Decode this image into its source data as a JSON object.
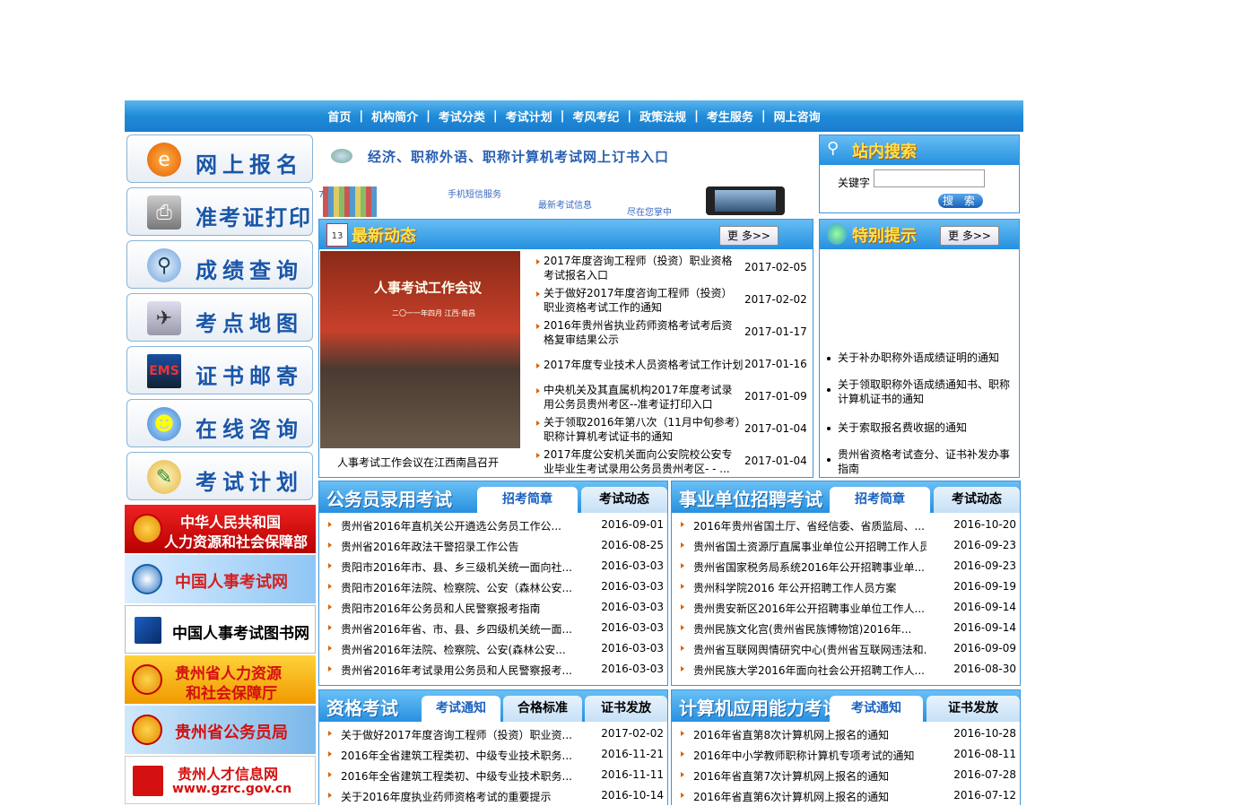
{
  "nav": [
    "首页",
    "机构简介",
    "考试分类",
    "考试计划",
    "考风考纪",
    "政策法规",
    "考生服务",
    "网上咨询"
  ],
  "nav_sep": "|",
  "quick_links": [
    "网上报名",
    "准考证打印",
    "成绩查询",
    "考点地图",
    "证书邮寄",
    "在线咨询",
    "考试计划"
  ],
  "banners": [
    {
      "line1": "中华人民共和国",
      "line2": "人力资源和社会保障部"
    },
    {
      "line1": "中国人事考试网"
    },
    {
      "line1": "中国人事考试图书网"
    },
    {
      "line1": "贵州省人力资源",
      "line2": "和社会保障厅"
    },
    {
      "line1": "贵州省公务员局"
    },
    {
      "line1": "贵州人才信息网",
      "line2": "www.gzrc.gov.cn"
    }
  ],
  "ad": {
    "main": "经济、职称外语、职称计算机考试网上订书入口",
    "sms": "手机短信服务",
    "latest": "最新考试信息",
    "palm": "尽在您掌中",
    "num": "7"
  },
  "search": {
    "title": "站内搜索",
    "keyword_label": "关键字",
    "button": "搜 索"
  },
  "news": {
    "title": "最新动态",
    "calendar": "13",
    "more": "更 多>>",
    "photo_banner": "人事考试工作会议",
    "photo_sub": "二〇一一年四月 江西·南昌",
    "photo_caption": "人事考试工作会议在江西南昌召开",
    "items": [
      {
        "t": "2017年度咨询工程师（投资）职业资格考试报名入口",
        "d": "2017-02-05"
      },
      {
        "t": "关于做好2017年度咨询工程师（投资）职业资格考试工作的通知",
        "d": "2017-02-02"
      },
      {
        "t": "2016年贵州省执业药师资格考试考后资格复审结果公示",
        "d": "2017-01-17"
      },
      {
        "t": "2017年度专业技术人员资格考试工作计划",
        "d": "2017-01-16"
      },
      {
        "t": "中央机关及其直属机构2017年度考试录用公务员贵州考区--准考证打印入口",
        "d": "2017-01-09"
      },
      {
        "t": "关于领取2016年第八次（11月中旬参考）职称计算机考试证书的通知",
        "d": "2017-01-04"
      },
      {
        "t": "2017年度公安机关面向公安院校公安专业毕业生考试录用公务员贵州考区- - ...",
        "d": "2017-01-04"
      }
    ]
  },
  "tips": {
    "title": "特别提示",
    "more": "更 多>>",
    "items": [
      "关于补办职称外语成绩证明的通知",
      "关于领取职称外语成绩通知书、职称计算机证书的通知",
      "关于索取报名费收据的通知",
      "贵州省资格考试查分、证书补发办事指南"
    ]
  },
  "civil": {
    "title": "公务员录用考试",
    "tabs": [
      "招考简章",
      "考试动态"
    ],
    "items": [
      {
        "t": "贵州省2016年直机关公开遴选公务员工作公...",
        "d": "2016-09-01"
      },
      {
        "t": "贵州省2016年政法干警招录工作公告",
        "d": "2016-08-25"
      },
      {
        "t": "贵阳市2016年市、县、乡三级机关统一面向社...",
        "d": "2016-03-03"
      },
      {
        "t": "贵阳市2016年法院、检察院、公安（森林公安...",
        "d": "2016-03-03"
      },
      {
        "t": "贵阳市2016年公务员和人民警察报考指南",
        "d": "2016-03-03"
      },
      {
        "t": "贵州省2016年省、市、县、乡四级机关统一面...",
        "d": "2016-03-03"
      },
      {
        "t": "贵州省2016年法院、检察院、公安(森林公安...",
        "d": "2016-03-03"
      },
      {
        "t": "贵州省2016年考试录用公务员和人民警察报考...",
        "d": "2016-03-03"
      }
    ]
  },
  "inst": {
    "title": "事业单位招聘考试",
    "tabs": [
      "招考简章",
      "考试动态"
    ],
    "items": [
      {
        "t": "2016年贵州省国土厅、省经信委、省质监局、...",
        "d": "2016-10-20"
      },
      {
        "t": "贵州省国土资源厅直属事业单位公开招聘工作人员...",
        "d": "2016-09-23"
      },
      {
        "t": "贵州省国家税务局系统2016年公开招聘事业单...",
        "d": "2016-09-23"
      },
      {
        "t": "贵州科学院2016 年公开招聘工作人员方案",
        "d": "2016-09-19"
      },
      {
        "t": "贵州贵安新区2016年公开招聘事业单位工作人...",
        "d": "2016-09-14"
      },
      {
        "t": "贵州民族文化宫(贵州省民族博物馆)2016年...",
        "d": "2016-09-14"
      },
      {
        "t": "贵州省互联网舆情研究中心(贵州省互联网违法和...",
        "d": "2016-09-09"
      },
      {
        "t": "贵州民族大学2016年面向社会公开招聘工作人...",
        "d": "2016-08-30"
      }
    ]
  },
  "qual": {
    "title": "资格考试",
    "tabs": [
      "考试通知",
      "合格标准",
      "证书发放"
    ],
    "items": [
      {
        "t": "关于做好2017年度咨询工程师（投资）职业资...",
        "d": "2017-02-02"
      },
      {
        "t": "2016年全省建筑工程类初、中级专业技术职务...",
        "d": "2016-11-21"
      },
      {
        "t": "2016年全省建筑工程类初、中级专业技术职务...",
        "d": "2016-11-11"
      },
      {
        "t": "关于2016年度执业药师资格考试的重要提示",
        "d": "2016-10-14"
      }
    ]
  },
  "comp": {
    "title": "计算机应用能力考试",
    "tabs": [
      "考试通知",
      "证书发放"
    ],
    "items": [
      {
        "t": "2016年省直第8次计算机网上报名的通知",
        "d": "2016-10-28"
      },
      {
        "t": "2016年中小学教师职称计算机专项考试的通知",
        "d": "2016-08-11"
      },
      {
        "t": "2016年省直第7次计算机网上报名的通知",
        "d": "2016-07-28"
      },
      {
        "t": "2016年省直第6次计算机网上报名的通知",
        "d": "2016-07-12"
      }
    ]
  }
}
